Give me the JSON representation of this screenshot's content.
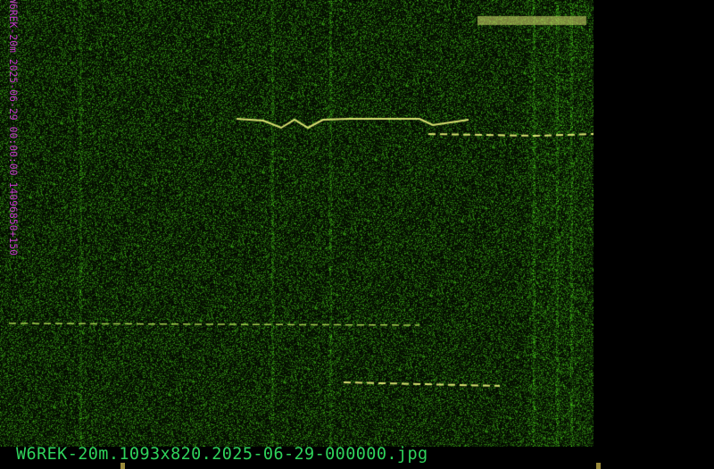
{
  "image": {
    "filename_label": "W6REK-20m.1093x820.2025-06-29-000000.jpg",
    "vertical_label": "W6REK-20m 2025-06-29 00:00:00 14096850+150"
  },
  "colors": {
    "background": "#000000",
    "signal_green": "#2fd35a",
    "signal_yellow": "#d8e070",
    "label_magenta": "#c236c8",
    "tick_marker": "#9a8a3a"
  }
}
